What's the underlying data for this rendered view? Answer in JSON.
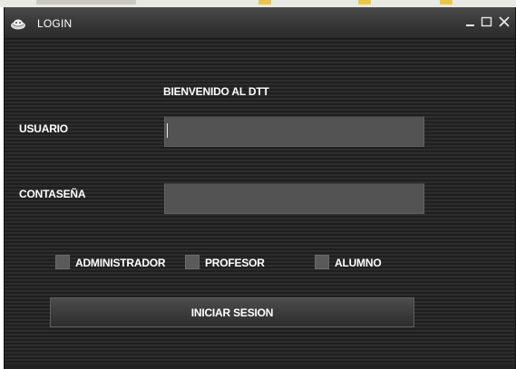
{
  "window": {
    "title": "LOGIN",
    "title_icon": "app-icon",
    "controls": [
      "minimize-icon",
      "maximize-icon",
      "close-icon"
    ]
  },
  "form": {
    "welcome": "BIENVENIDO AL DTT",
    "username_label": "USUARIO",
    "username_value": "",
    "password_label": "CONTASEÑA",
    "password_value": ""
  },
  "roles": [
    {
      "label": "ADMINISTRADOR",
      "checked": false
    },
    {
      "label": "PROFESOR",
      "checked": false
    },
    {
      "label": "ALUMNO",
      "checked": false
    }
  ],
  "actions": {
    "login_label": "INICIAR SESION"
  },
  "colors": {
    "window_background": "#262626",
    "input_background": "#535353",
    "text": "#ffffff"
  }
}
